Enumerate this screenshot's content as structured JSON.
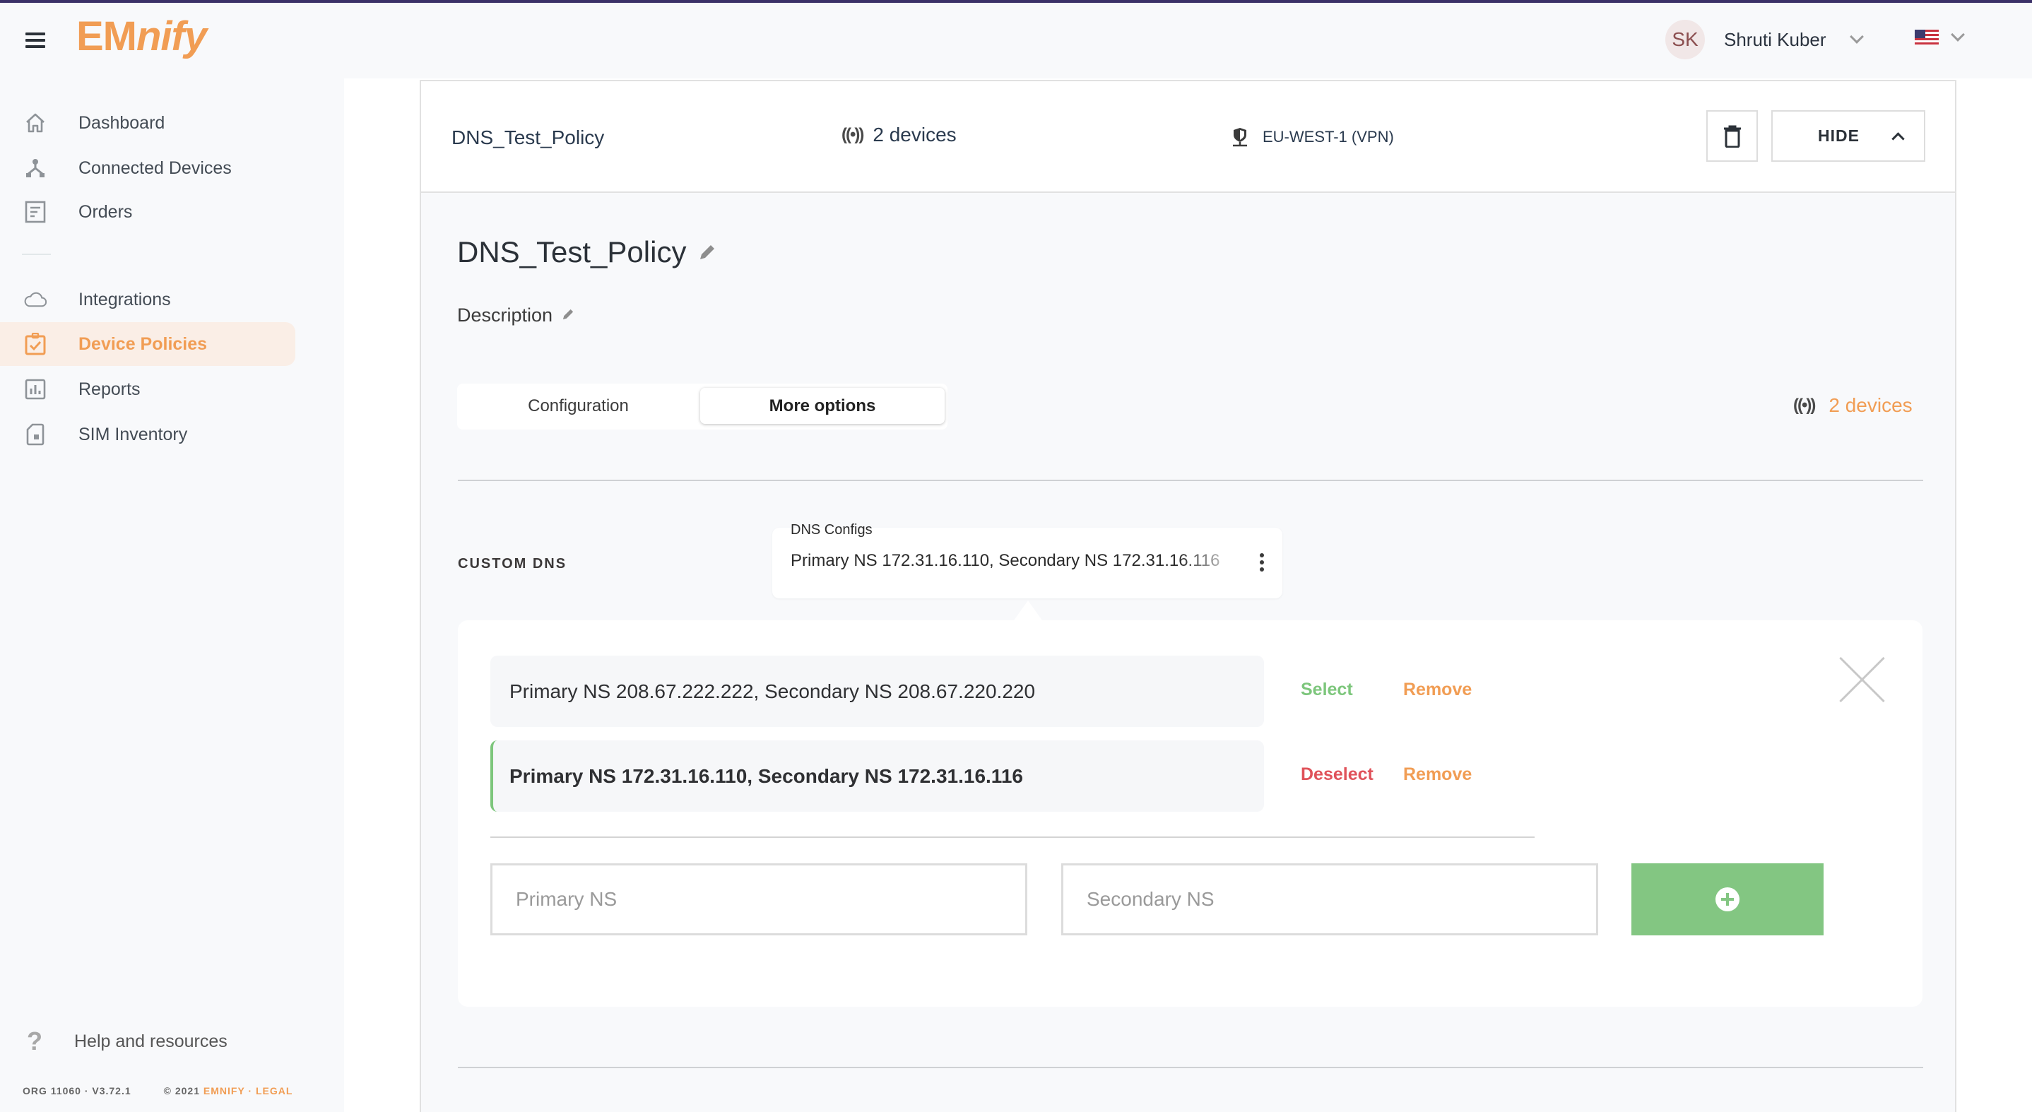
{
  "app": {
    "logo_upright": "EM",
    "logo_italic": "nify",
    "accent_color": "#f19d54"
  },
  "header": {
    "user_initials": "SK",
    "user_name": "Shruti Kuber",
    "language_flag": "us-flag-icon"
  },
  "sidebar": {
    "items": [
      {
        "label": "Dashboard",
        "icon": "home-icon",
        "active": false
      },
      {
        "label": "Connected Devices",
        "icon": "network-icon",
        "active": false
      },
      {
        "label": "Orders",
        "icon": "receipt-icon",
        "active": false
      },
      {
        "label": "Integrations",
        "icon": "cloud-icon",
        "active": false
      },
      {
        "label": "Device Policies",
        "icon": "clipboard-check-icon",
        "active": true
      },
      {
        "label": "Reports",
        "icon": "bar-chart-icon",
        "active": false
      },
      {
        "label": "SIM Inventory",
        "icon": "sim-card-icon",
        "active": false
      }
    ],
    "help_label": "Help and resources",
    "footer": {
      "org_version": "ORG 11060 · V3.72.1",
      "copyright": "© 2021",
      "brand_link": "EMNIFY",
      "separator": "·",
      "legal_link": "LEGAL"
    }
  },
  "policy_card": {
    "header": {
      "name": "DNS_Test_Policy",
      "devices": "2 devices",
      "region": "EU-WEST-1 (VPN)",
      "hide_label": "HIDE"
    },
    "title": "DNS_Test_Policy",
    "description_label": "Description",
    "tabs": [
      {
        "label": "Configuration",
        "active": false
      },
      {
        "label": "More options",
        "active": true
      }
    ],
    "devices_link": "2 devices",
    "custom_dns": {
      "section_label": "CUSTOM DNS",
      "select_label": "DNS Configs",
      "select_value": "Primary NS 172.31.16.110, Secondary NS 172.31.16.116",
      "configs": [
        {
          "text": "Primary NS 208.67.222.222, Secondary NS  208.67.220.220",
          "selected": false,
          "toggle_label": "Select",
          "remove_label": "Remove"
        },
        {
          "text": "Primary NS 172.31.16.110, Secondary NS  172.31.16.116",
          "selected": true,
          "toggle_label": "Deselect",
          "remove_label": "Remove"
        }
      ],
      "primary_placeholder": "Primary NS",
      "primary_value": "",
      "secondary_placeholder": "Secondary NS",
      "secondary_value": "",
      "colors": {
        "select": "#7dc67c",
        "deselect": "#e0525a",
        "remove": "#f19d54",
        "add_button": "#83c682"
      }
    }
  }
}
